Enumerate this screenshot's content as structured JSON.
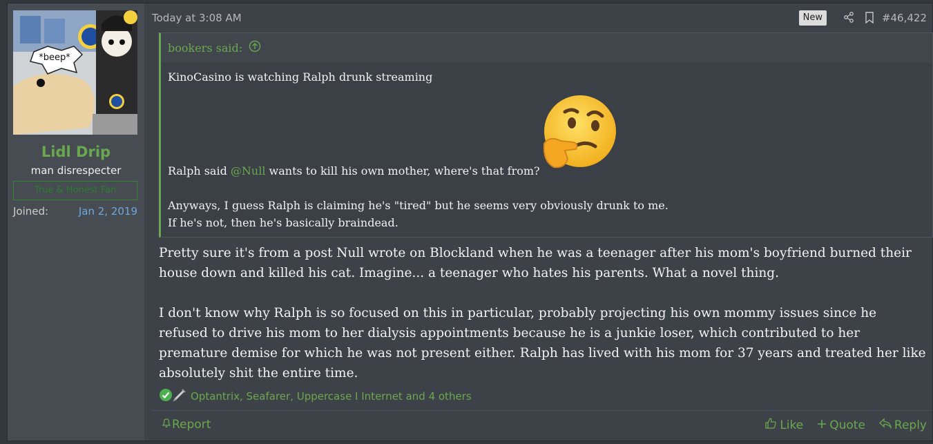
{
  "user": {
    "avatar_caption": "*beep*",
    "name": "Lidl Drip",
    "title": "man disrespecter",
    "banner": "True & Honest Fan",
    "joined_label": "Joined:",
    "joined_date": "Jan 2, 2019"
  },
  "post": {
    "timestamp": "Today at 3:08 AM",
    "new_badge": "New",
    "number": "#46,422",
    "quote": {
      "author": "bookers said:",
      "line1": "KinoCasino is watching Ralph drunk streaming",
      "line2_pre": "Ralph said ",
      "line2_mention": "@Null",
      "line2_post": " wants to kill his own mother, where's that from?",
      "line3": "Anyways, I guess Ralph is claiming he's \"tired\" but he seems very obviously drunk to me.",
      "line4": "If he's not, then he's basically braindead."
    },
    "body_p1": "Pretty sure it's from a post Null wrote on Blockland when he was a teenager after his mom's boyfriend burned their house down and killed his cat. Imagine... a teenager who hates his parents. What a novel thing.",
    "body_p2": "I don't know why Ralph is so focused on this in particular, probably projecting his own mommy issues since he refused to drive his mom to her dialysis appointments because he is a junkie loser, which contributed to her premature demise for which he was not present either. Ralph has lived with his mom for 37 years and treated her like absolutely shit the entire time.",
    "reactions_text": "Optantrix, Seafarer, Uppercase I Internet and 4 others"
  },
  "footer": {
    "report": "Report",
    "like": "Like",
    "quote": "Quote",
    "reply": "Reply"
  },
  "colors": {
    "accent": "#6aa84f",
    "link_blue": "#6fa8dc",
    "background": "#32363d",
    "post_bg": "#3d4148",
    "sidebar_bg": "#464c52"
  }
}
